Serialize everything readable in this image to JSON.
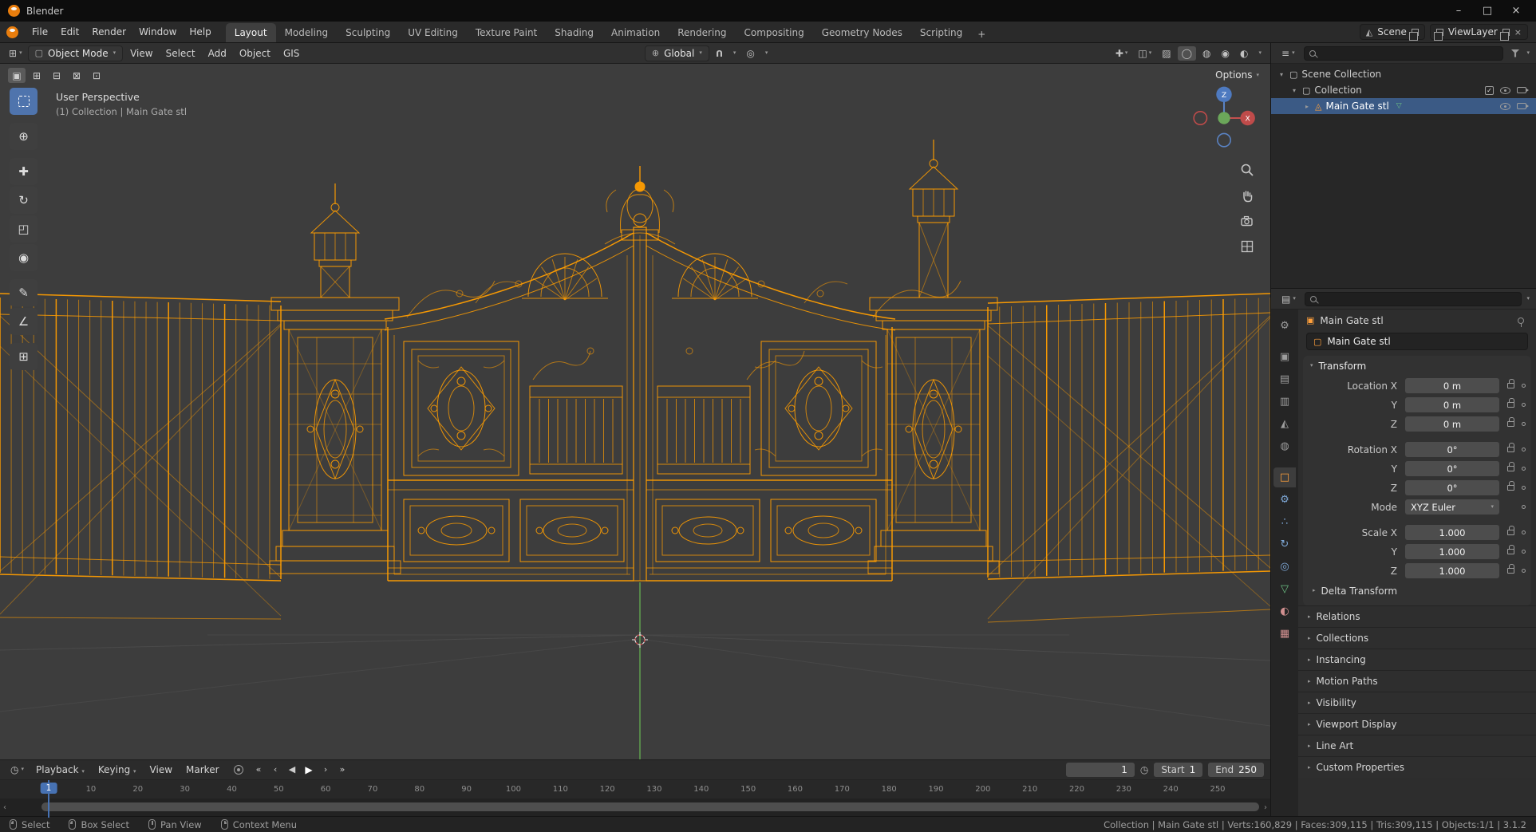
{
  "window": {
    "title": "Blender",
    "minimize": "–",
    "maximize": "□",
    "close": "×"
  },
  "topbar": {
    "menus": [
      "File",
      "Edit",
      "Render",
      "Window",
      "Help"
    ],
    "workspaces": [
      "Layout",
      "Modeling",
      "Sculpting",
      "UV Editing",
      "Texture Paint",
      "Shading",
      "Animation",
      "Rendering",
      "Compositing",
      "Geometry Nodes",
      "Scripting"
    ],
    "add_workspace": "+",
    "scene": "Scene",
    "view_layer": "ViewLayer"
  },
  "viewport": {
    "mode": "Object Mode",
    "menus": [
      "View",
      "Select",
      "Add",
      "Object",
      "GIS"
    ],
    "orientation": "Global",
    "options_label": "Options",
    "overlay_title": "User Perspective",
    "overlay_subtitle": "(1) Collection | Main Gate stl",
    "gizmo_axis_z": "Z",
    "gizmo_axis_x": "X"
  },
  "outliner": {
    "rows": [
      {
        "label": "Scene Collection"
      },
      {
        "label": "Collection"
      },
      {
        "label": "Main Gate stl"
      }
    ]
  },
  "properties": {
    "breadcrumb_object": "Main Gate stl",
    "object_name": "Main Gate stl",
    "transform_label": "Transform",
    "location": {
      "x_label": "Location X",
      "y_label": "Y",
      "z_label": "Z",
      "x": "0 m",
      "y": "0 m",
      "z": "0 m"
    },
    "rotation": {
      "x_label": "Rotation X",
      "y_label": "Y",
      "z_label": "Z",
      "x": "0°",
      "y": "0°",
      "z": "0°"
    },
    "mode_label": "Mode",
    "mode_value": "XYZ Euler",
    "scale": {
      "x_label": "Scale X",
      "y_label": "Y",
      "z_label": "Z",
      "x": "1.000",
      "y": "1.000",
      "z": "1.000"
    },
    "delta_label": "Delta Transform",
    "sections": [
      "Relations",
      "Collections",
      "Instancing",
      "Motion Paths",
      "Visibility",
      "Viewport Display",
      "Line Art",
      "Custom Properties"
    ]
  },
  "timeline": {
    "menus": [
      "Playback",
      "Keying",
      "View",
      "Marker"
    ],
    "frame_current": "1",
    "start_label": "Start",
    "start_value": "1",
    "end_label": "End",
    "end_value": "250",
    "ticks": [
      "10",
      "20",
      "30",
      "40",
      "50",
      "60",
      "70",
      "80",
      "90",
      "100",
      "110",
      "120",
      "130",
      "140",
      "150",
      "160",
      "170",
      "180",
      "190",
      "200",
      "210",
      "220",
      "230",
      "240",
      "250"
    ]
  },
  "statusbar": {
    "items": [
      "Select",
      "Box Select",
      "Pan View",
      "Context Menu"
    ],
    "stats": "Collection | Main Gate stl | Verts:160,829 | Faces:309,115 | Tris:309,115 | Objects:1/1 | 3.1.2"
  },
  "colors": {
    "accent": "#4772b3",
    "selection_orange": "#ff9d00",
    "axis_green": "#5f9e4e"
  }
}
